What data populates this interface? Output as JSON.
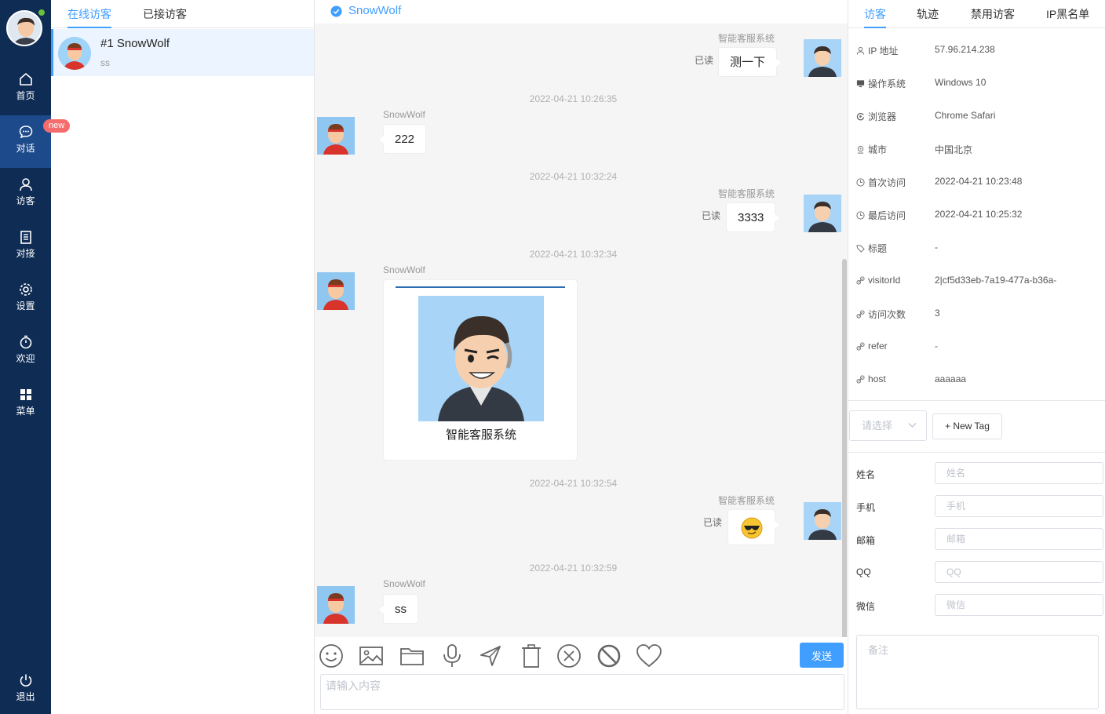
{
  "nav": {
    "items": [
      {
        "label": "首页",
        "icon": "home-icon"
      },
      {
        "label": "对话",
        "icon": "chat-icon"
      },
      {
        "label": "访客",
        "icon": "user-icon"
      },
      {
        "label": "对接",
        "icon": "book-icon"
      },
      {
        "label": "设置",
        "icon": "gear-icon"
      },
      {
        "label": "欢迎",
        "icon": "stopwatch-icon"
      },
      {
        "label": "菜单",
        "icon": "grid-icon"
      }
    ],
    "badge": "new",
    "logout": "退出"
  },
  "visitor_tabs": [
    "在线访客",
    "已接访客"
  ],
  "visitor_list": [
    {
      "name": "#1 SnowWolf",
      "last_message": "ss"
    }
  ],
  "chat": {
    "title": "SnowWolf",
    "messages": [
      {
        "side": "right",
        "sender": "智能客服系统",
        "text": "测一下",
        "status": "已读"
      },
      {
        "timestamp": "2022-04-21 10:26:35"
      },
      {
        "side": "left",
        "sender": "SnowWolf",
        "text": "222"
      },
      {
        "timestamp": "2022-04-21 10:32:24"
      },
      {
        "side": "right",
        "sender": "智能客服系统",
        "text": "3333",
        "status": "已读"
      },
      {
        "timestamp": "2022-04-21 10:32:34"
      },
      {
        "side": "left",
        "sender": "SnowWolf",
        "card_caption": "智能客服系统"
      },
      {
        "timestamp": "2022-04-21 10:32:54"
      },
      {
        "side": "right",
        "sender": "智能客服系统",
        "emoji": "sunglasses-emoji",
        "status": "已读"
      },
      {
        "timestamp": "2022-04-21 10:32:59"
      },
      {
        "side": "left",
        "sender": "SnowWolf",
        "text": "ss"
      }
    ],
    "tools": [
      "smiley-icon",
      "image-icon",
      "folder-icon",
      "microphone-icon",
      "send-arrow-icon",
      "trash-icon",
      "close-circle-icon",
      "block-icon",
      "heart-icon"
    ],
    "send_label": "发送",
    "input_placeholder": "请输入内容"
  },
  "info": {
    "tabs": [
      "访客",
      "轨迹",
      "禁用访客",
      "IP黑名单"
    ],
    "rows": [
      {
        "label": "IP 地址",
        "value": "57.96.214.238",
        "icon": "user-icon"
      },
      {
        "label": "操作系统",
        "value": "Windows 10",
        "icon": "monitor-icon"
      },
      {
        "label": "浏览器",
        "value": "Chrome Safari",
        "icon": "browser-icon"
      },
      {
        "label": "城市",
        "value": "中国北京",
        "icon": "location-icon"
      },
      {
        "label": "首次访问",
        "value": "2022-04-21 10:23:48",
        "icon": "clock-icon"
      },
      {
        "label": "最后访问",
        "value": "2022-04-21 10:25:32",
        "icon": "clock-icon"
      },
      {
        "label": "标题",
        "value": "-",
        "icon": "tag-icon"
      },
      {
        "label": "visitorId",
        "value": "2|cf5d33eb-7a19-477a-b36a-",
        "icon": "link-icon"
      },
      {
        "label": "访问次数",
        "value": "3",
        "icon": "link-icon"
      },
      {
        "label": "refer",
        "value": "-",
        "icon": "link-icon"
      },
      {
        "label": "host",
        "value": "aaaaaa",
        "icon": "link-icon"
      }
    ],
    "select_placeholder": "请选择",
    "new_tag_label": "+ New Tag",
    "fields": [
      {
        "label": "姓名",
        "placeholder": "姓名"
      },
      {
        "label": "手机",
        "placeholder": "手机"
      },
      {
        "label": "邮箱",
        "placeholder": "邮箱"
      },
      {
        "label": "QQ",
        "placeholder": "QQ"
      },
      {
        "label": "微信",
        "placeholder": "微信"
      }
    ],
    "remark_placeholder": "备注"
  },
  "colors": {
    "nav_bg": "#0f2c55",
    "nav_active": "#1d4a8b",
    "accent": "#409eff",
    "badge": "#f56c6c",
    "online": "#67c23a"
  }
}
